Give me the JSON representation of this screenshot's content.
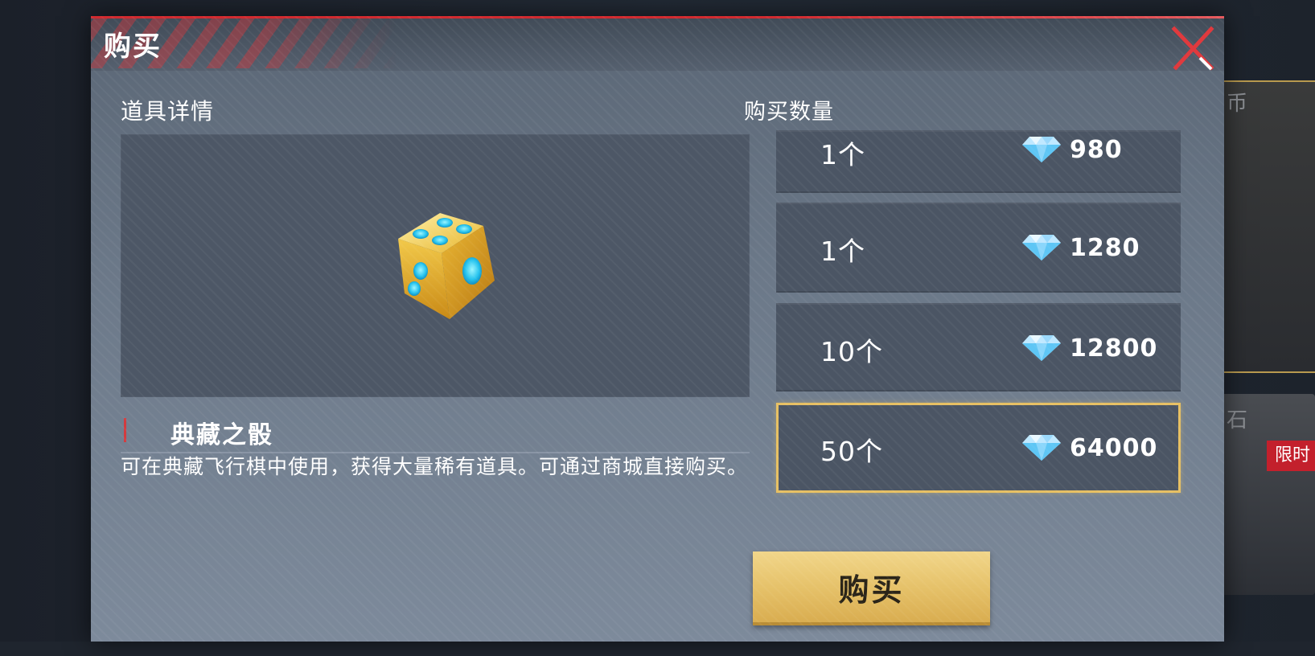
{
  "modal": {
    "title": "购买",
    "close_icon": "close-x-icon",
    "accent_color": "#d12a2f"
  },
  "detail": {
    "section_label": "道具详情",
    "item_icon": "golden-dice-icon",
    "item_name": "典藏之骰",
    "item_description": "可在典藏飞行棋中使用，获得大量稀有道具。可通过商城直接购买。"
  },
  "quantity": {
    "section_label": "购买数量",
    "currency_icon": "diamond-icon",
    "options": [
      {
        "label": "1个",
        "price": "980",
        "selected": false
      },
      {
        "label": "1个",
        "price": "1280",
        "selected": false
      },
      {
        "label": "10个",
        "price": "12800",
        "selected": false
      },
      {
        "label": "50个",
        "price": "64000",
        "selected": true
      }
    ],
    "selected_color": "#e7c063"
  },
  "actions": {
    "buy_label": "购买",
    "buy_color": "#e6c26a"
  },
  "background": {
    "partial_text_1": "币",
    "partial_text_2": "石",
    "badge": "限时"
  }
}
